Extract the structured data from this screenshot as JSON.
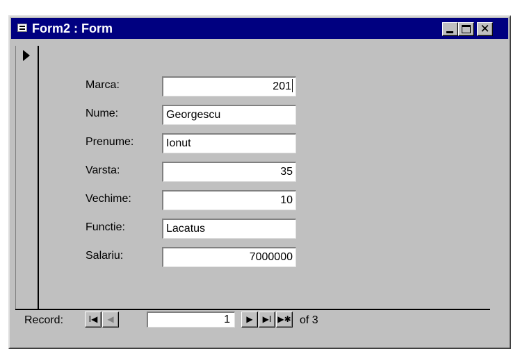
{
  "window": {
    "title": "Form2 : Form",
    "icon": "form-icon",
    "controls": {
      "minimize_icon": "minimize-icon",
      "maximize_icon": "maximize-icon",
      "close_glyph": "✕"
    }
  },
  "form": {
    "fields": [
      {
        "label": "Marca:",
        "value": "201",
        "align": "right"
      },
      {
        "label": "Nume:",
        "value": "Georgescu",
        "align": "left"
      },
      {
        "label": "Prenume:",
        "value": "Ionut",
        "align": "left"
      },
      {
        "label": "Varsta:",
        "value": "35",
        "align": "right"
      },
      {
        "label": "Vechime:",
        "value": "10",
        "align": "right"
      },
      {
        "label": "Functie:",
        "value": "Lacatus",
        "align": "left"
      },
      {
        "label": "Salariu:",
        "value": "7000000",
        "align": "right"
      }
    ]
  },
  "navigation": {
    "label": "Record:",
    "first_glyph": "I◀",
    "prev_glyph": "◀",
    "next_glyph": "▶",
    "last_glyph": "▶I",
    "new_glyph": "▶✱",
    "current": "1",
    "of_text": "of 3"
  },
  "colors": {
    "titlebar": "#000080",
    "window_face": "#c0c0c0",
    "field_background": "#ffffff"
  }
}
